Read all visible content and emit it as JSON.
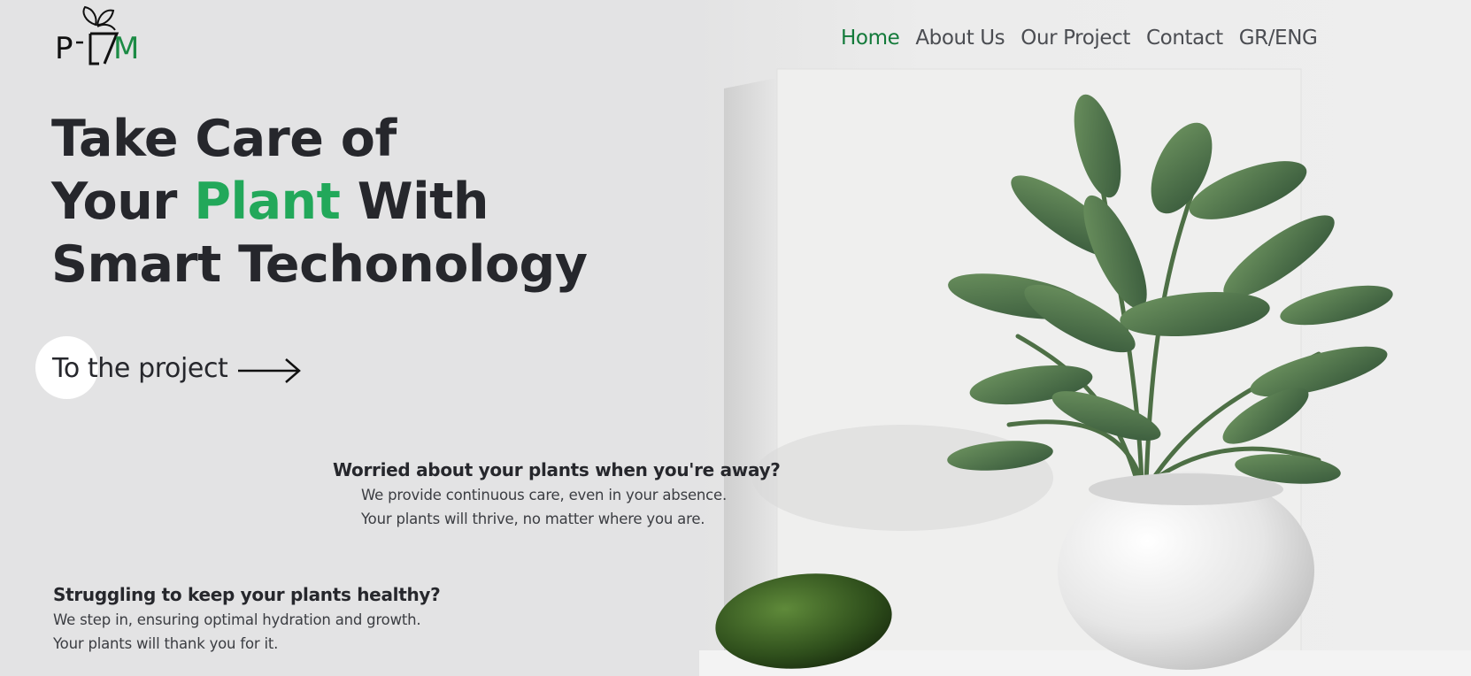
{
  "logo": {
    "letters": [
      "P",
      "-",
      "G",
      "M"
    ],
    "icon": "leaf-sprout-icon"
  },
  "nav": {
    "items": [
      {
        "label": "Home",
        "active": true
      },
      {
        "label": "About Us",
        "active": false
      },
      {
        "label": "Our Project",
        "active": false
      },
      {
        "label": "Contact",
        "active": false
      },
      {
        "label": "GR/ENG",
        "active": false
      }
    ]
  },
  "hero": {
    "line1": "Take Care of",
    "line2_pre": "Your",
    "line2_accent": "Plant",
    "line2_post": "With",
    "line3": "Smart Techonology",
    "cta_label": "To the project",
    "cta_icon": "arrow-right-icon"
  },
  "features": [
    {
      "title": "Worried about your plants when you're away?",
      "lines": [
        "We provide continuous care, even in your absence.",
        "Your plants will thrive, no matter where you are."
      ]
    },
    {
      "title": "Struggling to keep your plants healthy?",
      "lines": [
        "We step in, ensuring optimal hydration and growth.",
        "Your plants will thank you for it."
      ]
    }
  ],
  "colors": {
    "accent": "#22a85a",
    "nav_active": "#137a3a",
    "background": "#e3e3e4",
    "text": "#26272c"
  }
}
